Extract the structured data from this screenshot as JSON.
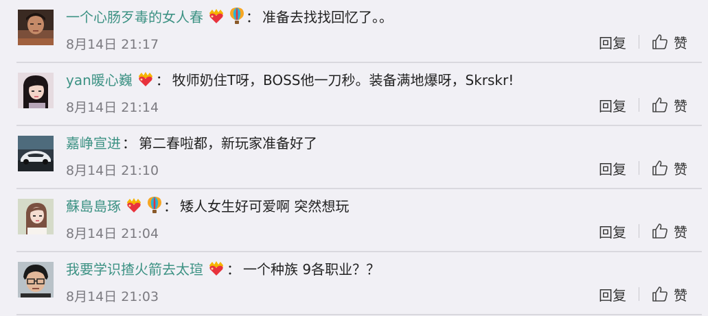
{
  "comments": [
    {
      "username": "一个心肠歹毒的女人春",
      "badges": [
        "crown-heart-icon",
        "balloon-icon"
      ],
      "colon": "：",
      "content": "准备去找找回忆了。。",
      "time": "8月14日 21:17",
      "reply_label": "回复",
      "like_label": "赞",
      "avatar": "avatar-boy"
    },
    {
      "username": "yan暖心巍",
      "badges": [
        "crown-heart-icon"
      ],
      "colon": "：",
      "content": "牧师奶住T呀，BOSS他一刀秒。装备满地爆呀，Skrskr!",
      "time": "8月14日 21:14",
      "reply_label": "回复",
      "like_label": "赞",
      "avatar": "avatar-girl-dark-hair"
    },
    {
      "username": "嘉峥宣进",
      "badges": [],
      "colon": "：",
      "content": "第二春啦都，新玩家准备好了",
      "time": "8月14日 21:10",
      "reply_label": "回复",
      "like_label": "赞",
      "avatar": "avatar-car"
    },
    {
      "username": "蘇島島琢",
      "badges": [
        "crown-heart-icon",
        "balloon-icon"
      ],
      "colon": "：",
      "content": "矮人女生好可爱啊 突然想玩",
      "time": "8月14日 21:04",
      "reply_label": "回复",
      "like_label": "赞",
      "avatar": "avatar-girl-light"
    },
    {
      "username": "我要学识揸火箭去太瑄",
      "badges": [
        "crown-heart-icon"
      ],
      "colon": "：",
      "content": "一个种族 9各职业？？",
      "time": "8月14日 21:03",
      "reply_label": "回复",
      "like_label": "赞",
      "avatar": "avatar-man-glasses"
    }
  ],
  "colors": {
    "username": "#3d9284",
    "background": "#f1f0f5",
    "time": "#7b7a80",
    "divider": "#d9d8de"
  }
}
